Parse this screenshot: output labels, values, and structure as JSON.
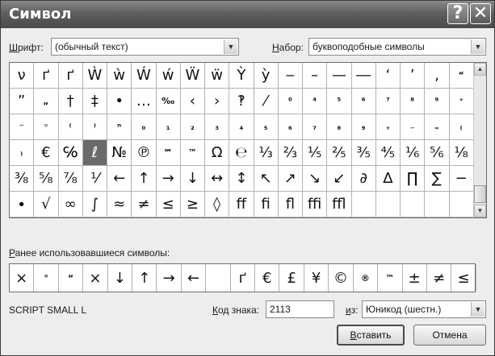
{
  "window": {
    "title": "Символ",
    "help_label": "?",
    "close_label": "✕"
  },
  "font": {
    "label_key": "Ш",
    "label_rest": "рифт:",
    "value": "(обычный текст)"
  },
  "subset": {
    "label_key": "Н",
    "label_rest": "абор:",
    "value": "буквоподобные символы"
  },
  "symbols": [
    "ν",
    "ґ",
    "ґ",
    "Ẁ",
    "ẁ",
    "Ẃ",
    "ẃ",
    "Ẅ",
    "ẅ",
    "Ỳ",
    "ỳ",
    "‒",
    "–",
    "—",
    "―",
    "‘",
    "’",
    "‚",
    "“",
    "”",
    "„",
    "†",
    "‡",
    "•",
    "…",
    "‰",
    "‹",
    "›",
    "‽",
    "⁄",
    "⁰",
    "⁴",
    "⁵",
    "⁶",
    "⁷",
    "⁸",
    "⁹",
    "⁺",
    "⁻",
    "⁼",
    "⁽",
    "⁾",
    "ⁿ",
    "₀",
    "₁",
    "₂",
    "₃",
    "₄",
    "₅",
    "₆",
    "₇",
    "₈",
    "₉",
    "₊",
    "₋",
    "₌",
    "₍",
    "₎",
    "€",
    "℅",
    "ℓ",
    "№",
    "℗",
    "℠",
    "™",
    "Ω",
    "℮",
    "⅓",
    "⅔",
    "⅕",
    "⅖",
    "⅗",
    "⅘",
    "⅙",
    "⅚",
    "⅛",
    "⅜",
    "⅝",
    "⅞",
    "⅟",
    "←",
    "↑",
    "→",
    "↓",
    "↔",
    "↕",
    "↖",
    "↗",
    "↘",
    "↙",
    "∂",
    "∆",
    "∏",
    "∑",
    "−",
    "∙",
    "√",
    "∞",
    "∫",
    "≈",
    "≠",
    "≤",
    "≥",
    "◊",
    "ﬀ",
    "ﬁ",
    "ﬂ",
    "ﬃ",
    "ﬄ",
    "",
    "",
    "",
    "",
    ""
  ],
  "small_symbols": [
    "⁰",
    "⁴",
    "⁵",
    "⁶",
    "⁷",
    "⁸",
    "⁹",
    "⁺",
    "⁻",
    "⁼",
    "⁽",
    "⁾",
    "ⁿ",
    "₀",
    "₁",
    "₂",
    "₃",
    "₄",
    "₅",
    "₆",
    "₇",
    "₈",
    "₉",
    "₊",
    "₋",
    "₌",
    "₍",
    "₎",
    "℠",
    "™",
    "‰",
    "“",
    "„",
    "°",
    "®"
  ],
  "selected_index": 60,
  "recent": {
    "label_key": "Р",
    "label_rest": "анее использовавшиеся символы:",
    "items": [
      "×",
      "°",
      "“",
      "×",
      "↓",
      "↑",
      "→",
      "←",
      "",
      "ґ",
      "€",
      "£",
      "¥",
      "©",
      "®",
      "™",
      "±",
      "≠",
      "≤"
    ]
  },
  "char_name": "SCRIPT SMALL L",
  "char_code": {
    "label_key": "К",
    "label_rest": "од знака:",
    "value": "2113"
  },
  "from": {
    "label_key": "и",
    "label_rest": "з:",
    "value": "Юникод (шестн.)"
  },
  "buttons": {
    "insert_key": "В",
    "insert_rest": "ставить",
    "cancel": "Отмена"
  },
  "colors": {
    "titlebar": "#5e5e5e",
    "selected_cell": "#6a6a6a"
  }
}
